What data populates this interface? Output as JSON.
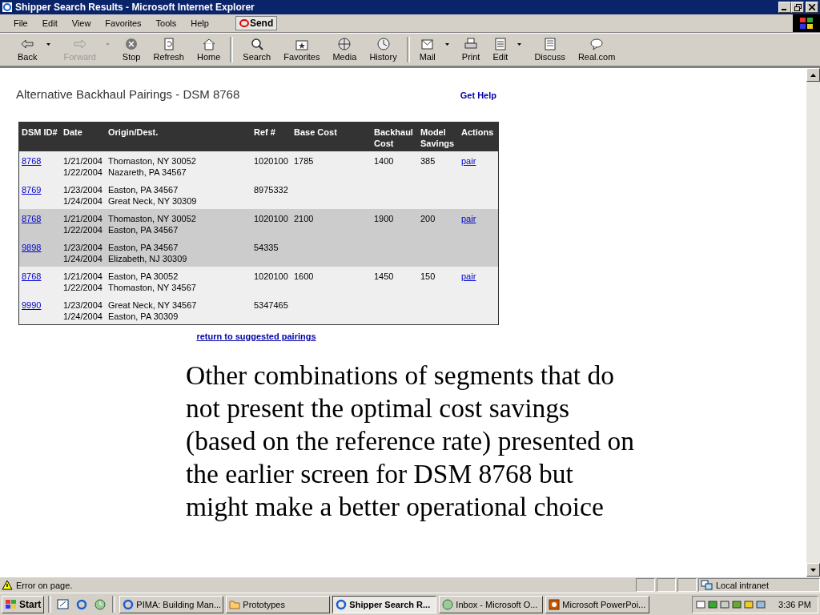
{
  "window": {
    "title": "Shipper Search Results - Microsoft Internet Explorer"
  },
  "menu": [
    "File",
    "Edit",
    "View",
    "Favorites",
    "Tools",
    "Help"
  ],
  "send_button": "Send",
  "toolbar": [
    {
      "label": "Back",
      "disabled": false,
      "dropdown": true
    },
    {
      "label": "Forward",
      "disabled": true,
      "dropdown": true
    },
    {
      "label": "Stop",
      "disabled": false,
      "dropdown": false
    },
    {
      "label": "Refresh",
      "disabled": false,
      "dropdown": false
    },
    {
      "label": "Home",
      "disabled": false,
      "dropdown": false
    },
    {
      "label": "Search",
      "disabled": false,
      "dropdown": false
    },
    {
      "label": "Favorites",
      "disabled": false,
      "dropdown": false
    },
    {
      "label": "Media",
      "disabled": false,
      "dropdown": false
    },
    {
      "label": "History",
      "disabled": false,
      "dropdown": false
    },
    {
      "label": "Mail",
      "disabled": false,
      "dropdown": true
    },
    {
      "label": "Print",
      "disabled": false,
      "dropdown": false
    },
    {
      "label": "Edit",
      "disabled": false,
      "dropdown": true
    },
    {
      "label": "Discuss",
      "disabled": false,
      "dropdown": false
    },
    {
      "label": "Real.com",
      "disabled": false,
      "dropdown": false
    }
  ],
  "page": {
    "heading": "Alternative Backhaul Pairings - DSM 8768",
    "help_link": "Get Help",
    "table": {
      "columns": [
        "DSM ID#",
        "Date",
        "Origin/Dest.",
        "Ref #",
        "Base Cost",
        "Backhaul Cost",
        "Model Savings",
        "Actions"
      ],
      "groups": [
        {
          "highlighted": false,
          "rows": [
            {
              "dsm_id": "8768",
              "dates": [
                "1/21/2004",
                "1/22/2004"
              ],
              "places": [
                "Thomaston, NY 30052",
                "Nazareth, PA 34567"
              ],
              "ref": "1020100",
              "base_cost": "1785",
              "backhaul_cost": "1400",
              "savings": "385",
              "action": "pair"
            },
            {
              "dsm_id": "8769",
              "dates": [
                "1/23/2004",
                "1/24/2004"
              ],
              "places": [
                "Easton, PA 34567",
                "Great Neck, NY 30309"
              ],
              "ref": "8975332"
            }
          ]
        },
        {
          "highlighted": true,
          "rows": [
            {
              "dsm_id": "8768",
              "dates": [
                "1/21/2004",
                "1/22/2004"
              ],
              "places": [
                "Thomaston, NY 30052",
                "Easton, PA 34567"
              ],
              "ref": "1020100",
              "base_cost": "2100",
              "backhaul_cost": "1900",
              "savings": "200",
              "action": "pair"
            },
            {
              "dsm_id": "9898",
              "dates": [
                "1/23/2004",
                "1/24/2004"
              ],
              "places": [
                "Easton, PA 34567",
                "Elizabeth, NJ 30309"
              ],
              "ref": "54335"
            }
          ]
        },
        {
          "highlighted": false,
          "rows": [
            {
              "dsm_id": "8768",
              "dates": [
                "1/21/2004",
                "1/22/2004"
              ],
              "places": [
                "Easton, PA 30052",
                "Thomaston, NY 34567"
              ],
              "ref": "1020100",
              "base_cost": "1600",
              "backhaul_cost": "1450",
              "savings": "150",
              "action": "pair"
            },
            {
              "dsm_id": "9990",
              "dates": [
                "1/23/2004",
                "1/24/2004"
              ],
              "places": [
                "Great Neck, NY 34567",
                "Easton, PA 30309"
              ],
              "ref": "5347465"
            }
          ]
        }
      ]
    },
    "return_link": "return to suggested pairings",
    "note": "Other combinations of segments that do not present the optimal cost savings (based on the reference rate) presented on the earlier screen for DSM 8768 but might make a better operational choice"
  },
  "status_bar": {
    "message": "Error on page.",
    "zone": "Local intranet"
  },
  "taskbar": {
    "start": "Start",
    "tasks": [
      {
        "label": "PIMA: Building Man...",
        "selected": false
      },
      {
        "label": "Prototypes",
        "selected": false
      },
      {
        "label": "Shipper Search R...",
        "selected": true
      },
      {
        "label": "Inbox - Microsoft O...",
        "selected": false
      },
      {
        "label": "Microsoft PowerPoi...",
        "selected": false
      }
    ],
    "clock": "3:36 PM"
  }
}
